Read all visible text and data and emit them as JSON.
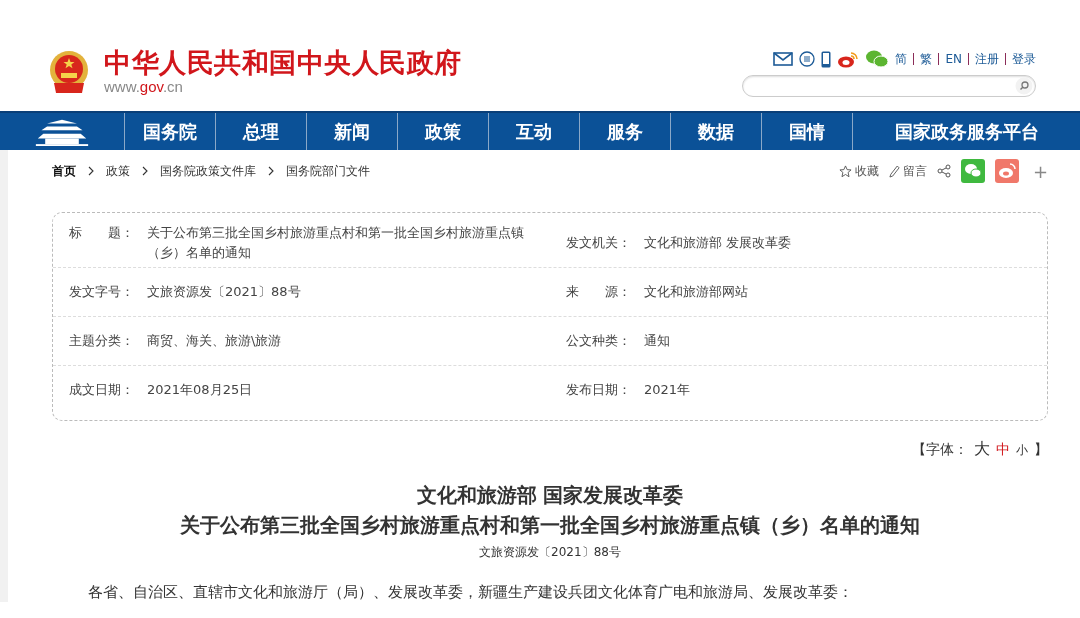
{
  "header": {
    "site_title": "中华人民共和国中央人民政府",
    "site_url_prefix": "www.",
    "site_url_domain": "gov",
    "site_url_suffix": ".cn",
    "links": [
      "简",
      "繁",
      "EN",
      "注册",
      "登录"
    ]
  },
  "nav": {
    "items": [
      "国务院",
      "总理",
      "新闻",
      "政策",
      "互动",
      "服务",
      "数据",
      "国情",
      "国家政务服务平台"
    ]
  },
  "breadcrumb": [
    "首页",
    "政策",
    "国务院政策文件库",
    "国务院部门文件"
  ],
  "actions": {
    "favorite": "收藏",
    "comment": "留言",
    "more": "+"
  },
  "info": {
    "rows": [
      [
        {
          "label": "标　　题：",
          "value": "关于公布第三批全国乡村旅游重点村和第一批全国乡村旅游重点镇（乡）名单的通知"
        },
        {
          "label": "发文机关：",
          "value": "文化和旅游部 发展改革委"
        }
      ],
      [
        {
          "label": "发文字号：",
          "value": "文旅资源发〔2021〕88号"
        },
        {
          "label": "来　　源：",
          "value": "文化和旅游部网站"
        }
      ],
      [
        {
          "label": "主题分类：",
          "value": "商贸、海关、旅游\\旅游"
        },
        {
          "label": "公文种类：",
          "value": "通知"
        }
      ],
      [
        {
          "label": "成文日期：",
          "value": "2021年08月25日"
        },
        {
          "label": "发布日期：",
          "value": "2021年"
        }
      ]
    ]
  },
  "font_size": {
    "open": "【字体：",
    "close": "】",
    "options": [
      {
        "label": "大",
        "selected": false
      },
      {
        "label": "中",
        "selected": true
      },
      {
        "label": "小",
        "selected": false
      }
    ]
  },
  "article": {
    "title_line_1": "文化和旅游部 国家发展改革委",
    "title_line_2": "关于公布第三批全国乡村旅游重点村和第一批全国乡村旅游重点镇（乡）名单的通知",
    "doc_number": "文旅资源发〔2021〕88号",
    "salutation": "各省、自治区、直辖市文化和旅游厅（局）、发展改革委，新疆生产建设兵团文化体育广电和旅游局、发展改革委："
  }
}
